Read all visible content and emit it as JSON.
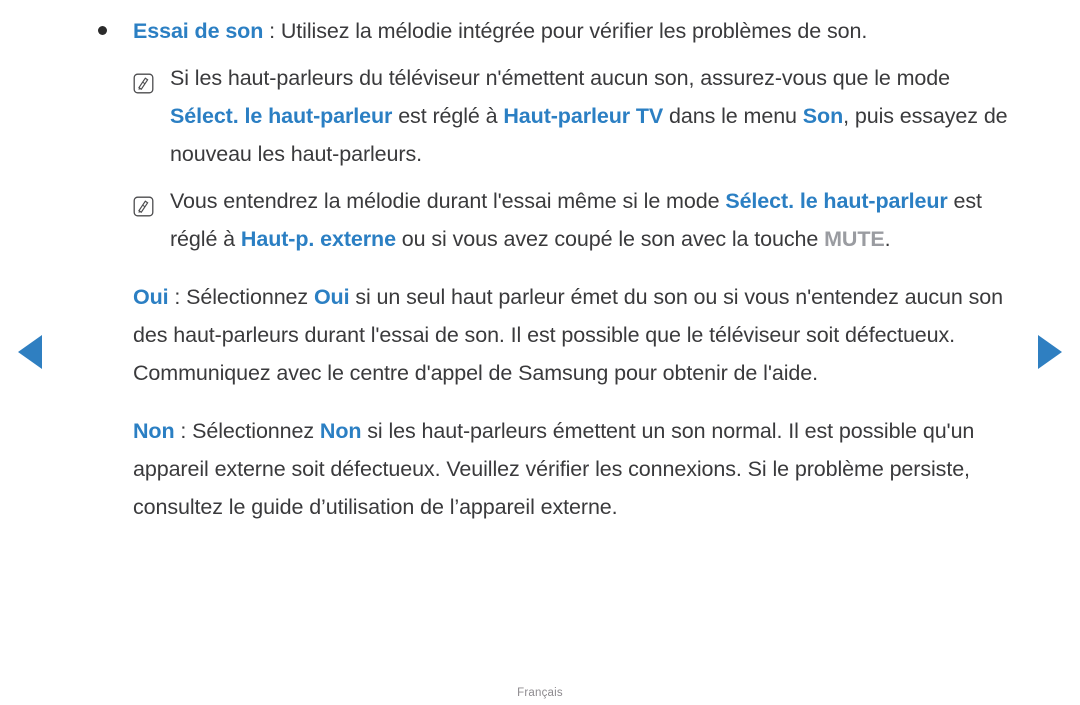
{
  "accent_color": "#2b7fc3",
  "body_color": "#3a3a3c",
  "key_color": "#9a9ca1",
  "background_color": "#ffffff",
  "nav": {
    "prev_label": "◀",
    "next_label": "▶",
    "prev_name": "previous-page-arrow",
    "next_name": "next-page-arrow"
  },
  "footer": {
    "language": "Français"
  },
  "content": {
    "bullet_item": {
      "term": "Essai de son",
      "separator": " : ",
      "text": "Utilisez la mélodie intégrée pour vérifier les problèmes de son."
    },
    "notes": [
      {
        "icon": "note-pencil-icon",
        "segments": [
          {
            "type": "plain",
            "text": "Si les haut-parleurs du téléviseur n'émettent aucun son, assurez-vous que le mode "
          },
          {
            "type": "keyword",
            "text": "Sélect. le haut-parleur"
          },
          {
            "type": "plain",
            "text": " est réglé à "
          },
          {
            "type": "keyword",
            "text": "Haut-parleur TV"
          },
          {
            "type": "plain",
            "text": " dans le menu "
          },
          {
            "type": "keyword",
            "text": "Son"
          },
          {
            "type": "plain",
            "text": ", puis essayez de nouveau les haut-parleurs."
          }
        ]
      },
      {
        "icon": "note-pencil-icon",
        "segments": [
          {
            "type": "plain",
            "text": "Vous entendrez la mélodie durant l'essai même si le mode "
          },
          {
            "type": "keyword",
            "text": "Sélect. le haut-parleur"
          },
          {
            "type": "plain",
            "text": " est réglé à "
          },
          {
            "type": "keyword",
            "text": "Haut-p. externe"
          },
          {
            "type": "plain",
            "text": " ou si vous avez coupé le son avec la touche "
          },
          {
            "type": "key",
            "text": "MUTE"
          },
          {
            "type": "plain",
            "text": "."
          }
        ]
      }
    ],
    "options": [
      {
        "segments": [
          {
            "type": "keyword",
            "text": "Oui"
          },
          {
            "type": "plain",
            "text": " : Sélectionnez "
          },
          {
            "type": "keyword",
            "text": "Oui"
          },
          {
            "type": "plain",
            "text": " si un seul haut parleur émet du son ou si vous n'entendez aucun son des haut-parleurs durant l'essai de son. Il est possible que le téléviseur soit défectueux. Communiquez avec le centre d'appel de Samsung pour obtenir de l'aide."
          }
        ]
      },
      {
        "segments": [
          {
            "type": "keyword",
            "text": "Non"
          },
          {
            "type": "plain",
            "text": " : Sélectionnez "
          },
          {
            "type": "keyword",
            "text": "Non"
          },
          {
            "type": "plain",
            "text": " si les haut-parleurs émettent un son normal. Il est possible qu'un appareil externe soit défectueux. Veuillez vérifier les connexions. Si le problème persiste, consultez le guide d’utilisation de l’appareil externe."
          }
        ]
      }
    ]
  }
}
